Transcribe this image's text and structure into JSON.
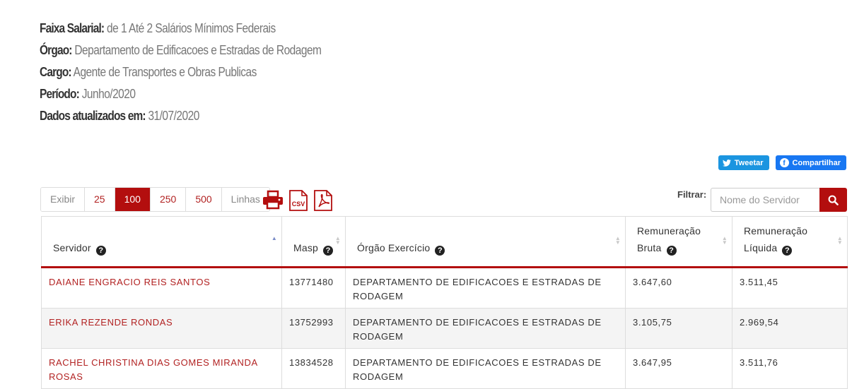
{
  "info": [
    {
      "label": "Faixa Salarial:",
      "value": " de 1 Até 2 Salários Mínimos Federais"
    },
    {
      "label": "Órgao:",
      "value": " Departamento de Edificacoes e Estradas de Rodagem"
    },
    {
      "label": "Cargo:",
      "value": " Agente de Transportes e Obras Publicas"
    },
    {
      "label": "Período:",
      "value": " Junho/2020"
    },
    {
      "label": "Dados atualizados em:",
      "value": " 31/07/2020"
    }
  ],
  "social": {
    "tweet": "Tweetar",
    "share": "Compartilhar"
  },
  "pager": {
    "show": "Exibir",
    "options": [
      "25",
      "100",
      "250",
      "500"
    ],
    "selected": "100",
    "rows": "Linhas"
  },
  "export": {
    "print": "print-icon",
    "csv": "CSV",
    "pdf": "pdf-icon"
  },
  "filter": {
    "label": "Filtrar:",
    "placeholder": "Nome do Servidor"
  },
  "table": {
    "headers": [
      {
        "line1": "",
        "line2": "Servidor"
      },
      {
        "line1": "",
        "line2": "Masp"
      },
      {
        "line1": "",
        "line2": "Órgão Exercício"
      },
      {
        "line1": "Remuneração",
        "line2": "Bruta"
      },
      {
        "line1": "Remuneração",
        "line2": "Líquida"
      }
    ],
    "rows": [
      {
        "servidor": "DAIANE ENGRACIO REIS SANTOS",
        "masp": "13771480",
        "orgao": "DEPARTAMENTO DE EDIFICACOES E ESTRADAS DE RODAGEM",
        "bruta": "3.647,60",
        "liquida": "3.511,45"
      },
      {
        "servidor": "ERIKA REZENDE RONDAS",
        "masp": "13752993",
        "orgao": "DEPARTAMENTO DE EDIFICACOES E ESTRADAS DE RODAGEM",
        "bruta": "3.105,75",
        "liquida": "2.969,54"
      },
      {
        "servidor": "RACHEL CHRISTINA DIAS GOMES MIRANDA ROSAS",
        "masp": "13834528",
        "orgao": "DEPARTAMENTO DE EDIFICACOES E ESTRADAS DE RODAGEM",
        "bruta": "3.647,95",
        "liquida": "3.511,76"
      }
    ]
  },
  "colors": {
    "accent": "#b30e0e",
    "link": "#b22222",
    "twitter": "#1b95e0",
    "facebook": "#1877f2"
  }
}
